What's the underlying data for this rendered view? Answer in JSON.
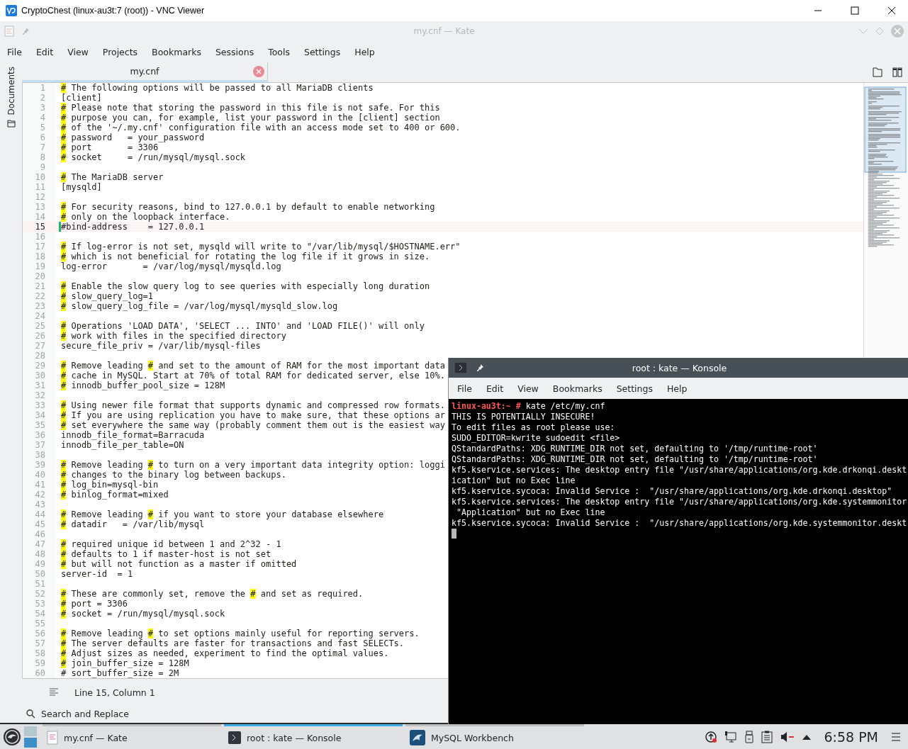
{
  "vnc_window": {
    "title": "CryptoChest (linux-au3t:7 (root)) - VNC Viewer"
  },
  "kate": {
    "title": "my.cnf — Kate",
    "menu": [
      "File",
      "Edit",
      "View",
      "Projects",
      "Bookmarks",
      "Sessions",
      "Tools",
      "Settings",
      "Help"
    ],
    "sidebar_tab": "Documents",
    "tabs": [
      {
        "label": "my.cnf",
        "selected": true
      }
    ],
    "lines": [
      {
        "number": "1",
        "current": false,
        "segments": [
          {
            "text": "#",
            "highlighted": true
          },
          {
            "text": " The following options will be passed to all MariaDB clients",
            "highlighted": false
          }
        ]
      },
      {
        "number": "2",
        "current": false,
        "segments": [
          {
            "text": "[client]",
            "highlighted": false
          }
        ]
      },
      {
        "number": "3",
        "current": false,
        "segments": [
          {
            "text": "#",
            "highlighted": true
          },
          {
            "text": " Please note that storing the password in this file is not safe. For this",
            "highlighted": false
          }
        ]
      },
      {
        "number": "4",
        "current": false,
        "segments": [
          {
            "text": "#",
            "highlighted": true
          },
          {
            "text": " purpose you can, for example, list your password in the [client] section",
            "highlighted": false
          }
        ]
      },
      {
        "number": "5",
        "current": false,
        "segments": [
          {
            "text": "#",
            "highlighted": true
          },
          {
            "text": " of the '~/.my.cnf' configuration file with an access mode set to 400 or 600.",
            "highlighted": false
          }
        ]
      },
      {
        "number": "6",
        "current": false,
        "segments": [
          {
            "text": "#",
            "highlighted": true
          },
          {
            "text": " password   = your_password",
            "highlighted": false
          }
        ]
      },
      {
        "number": "7",
        "current": false,
        "segments": [
          {
            "text": "#",
            "highlighted": true
          },
          {
            "text": " port       = 3306",
            "highlighted": false
          }
        ]
      },
      {
        "number": "8",
        "current": false,
        "segments": [
          {
            "text": "#",
            "highlighted": true
          },
          {
            "text": " socket     = /run/mysql/mysql.sock",
            "highlighted": false
          }
        ]
      },
      {
        "number": "9",
        "current": false
      },
      {
        "number": "10",
        "current": false,
        "segments": [
          {
            "text": "#",
            "highlighted": true
          },
          {
            "text": " The MariaDB server",
            "highlighted": false
          }
        ]
      },
      {
        "number": "11",
        "current": false,
        "segments": [
          {
            "text": "[mysqld]",
            "highlighted": false
          }
        ]
      },
      {
        "number": "12",
        "current": false
      },
      {
        "number": "13",
        "current": false,
        "segments": [
          {
            "text": "#",
            "highlighted": true
          },
          {
            "text": " For security reasons, bind to 127.0.0.1 by default to enable networking",
            "highlighted": false
          }
        ]
      },
      {
        "number": "14",
        "current": false,
        "segments": [
          {
            "text": "#",
            "highlighted": true
          },
          {
            "text": " only on the loopback interface.",
            "highlighted": false
          }
        ]
      },
      {
        "number": "15",
        "current": true,
        "segments": [
          {
            "text": "#bind-address    = 127.0.0.1",
            "highlighted": false
          }
        ]
      },
      {
        "number": "16",
        "current": false
      },
      {
        "number": "17",
        "current": false,
        "segments": [
          {
            "text": "#",
            "highlighted": true
          },
          {
            "text": " If log-error is not set, mysqld will write to \"/var/lib/mysql/$HOSTNAME.err\"",
            "highlighted": false
          }
        ]
      },
      {
        "number": "18",
        "current": false,
        "segments": [
          {
            "text": "#",
            "highlighted": true
          },
          {
            "text": " which is not beneficial for rotating the log file if it grows in size.",
            "highlighted": false
          }
        ]
      },
      {
        "number": "19",
        "current": false,
        "segments": [
          {
            "text": "log-error       = /var/log/mysql/mysqld.log",
            "highlighted": false
          }
        ]
      },
      {
        "number": "20",
        "current": false
      },
      {
        "number": "21",
        "current": false,
        "segments": [
          {
            "text": "#",
            "highlighted": true
          },
          {
            "text": " Enable the slow query log to see queries with especially long duration",
            "highlighted": false
          }
        ]
      },
      {
        "number": "22",
        "current": false,
        "segments": [
          {
            "text": "#",
            "highlighted": true
          },
          {
            "text": " slow_query_log=1",
            "highlighted": false
          }
        ]
      },
      {
        "number": "23",
        "current": false,
        "segments": [
          {
            "text": "#",
            "highlighted": true
          },
          {
            "text": " slow_query_log_file = /var/log/mysql/mysqld_slow.log",
            "highlighted": false
          }
        ]
      },
      {
        "number": "24",
        "current": false
      },
      {
        "number": "25",
        "current": false,
        "segments": [
          {
            "text": "#",
            "highlighted": true
          },
          {
            "text": " Operations 'LOAD DATA', 'SELECT ... INTO' and 'LOAD FILE()' will only",
            "highlighted": false
          }
        ]
      },
      {
        "number": "26",
        "current": false,
        "segments": [
          {
            "text": "#",
            "highlighted": true
          },
          {
            "text": " work with files in the specified directory",
            "highlighted": false
          }
        ]
      },
      {
        "number": "27",
        "current": false,
        "segments": [
          {
            "text": "secure_file_priv = /var/lib/mysql-files",
            "highlighted": false
          }
        ]
      },
      {
        "number": "28",
        "current": false
      },
      {
        "number": "29",
        "current": false,
        "segments": [
          {
            "text": "#",
            "highlighted": true
          },
          {
            "text": " Remove leading ",
            "highlighted": false
          },
          {
            "text": "#",
            "highlighted": true
          },
          {
            "text": " and set to the amount of RAM for the most important data",
            "highlighted": false
          }
        ]
      },
      {
        "number": "30",
        "current": false,
        "segments": [
          {
            "text": "#",
            "highlighted": true
          },
          {
            "text": " cache in MySQL. Start at 70% of total RAM for dedicated server, else 10%.",
            "highlighted": false
          }
        ]
      },
      {
        "number": "31",
        "current": false,
        "segments": [
          {
            "text": "#",
            "highlighted": true
          },
          {
            "text": " innodb_buffer_pool_size = 128M",
            "highlighted": false
          }
        ]
      },
      {
        "number": "32",
        "current": false
      },
      {
        "number": "33",
        "current": false,
        "segments": [
          {
            "text": "#",
            "highlighted": true
          },
          {
            "text": " Using newer file format that supports dynamic and compressed row formats.",
            "highlighted": false
          }
        ]
      },
      {
        "number": "34",
        "current": false,
        "segments": [
          {
            "text": "#",
            "highlighted": true
          },
          {
            "text": " If you are using replication you have to make sure, that these options ar",
            "highlighted": false
          }
        ]
      },
      {
        "number": "35",
        "current": false,
        "segments": [
          {
            "text": "#",
            "highlighted": true
          },
          {
            "text": " set everywhere the same way (probably comment them out is the easiest way",
            "highlighted": false
          }
        ]
      },
      {
        "number": "36",
        "current": false,
        "segments": [
          {
            "text": "innodb_file_format=Barracuda",
            "highlighted": false
          }
        ]
      },
      {
        "number": "37",
        "current": false,
        "segments": [
          {
            "text": "innodb_file_per_table=ON",
            "highlighted": false
          }
        ]
      },
      {
        "number": "38",
        "current": false
      },
      {
        "number": "39",
        "current": false,
        "segments": [
          {
            "text": "#",
            "highlighted": true
          },
          {
            "text": " Remove leading ",
            "highlighted": false
          },
          {
            "text": "#",
            "highlighted": true
          },
          {
            "text": " to turn on a very important data integrity option: loggi",
            "highlighted": false
          }
        ]
      },
      {
        "number": "40",
        "current": false,
        "segments": [
          {
            "text": "#",
            "highlighted": true
          },
          {
            "text": " changes to the binary log between backups.",
            "highlighted": false
          }
        ]
      },
      {
        "number": "41",
        "current": false,
        "segments": [
          {
            "text": "#",
            "highlighted": true
          },
          {
            "text": " log_bin=mysql-bin",
            "highlighted": false
          }
        ]
      },
      {
        "number": "42",
        "current": false,
        "segments": [
          {
            "text": "#",
            "highlighted": true
          },
          {
            "text": " binlog_format=mixed",
            "highlighted": false
          }
        ]
      },
      {
        "number": "43",
        "current": false
      },
      {
        "number": "44",
        "current": false,
        "segments": [
          {
            "text": "#",
            "highlighted": true
          },
          {
            "text": " Remove leading ",
            "highlighted": false
          },
          {
            "text": "#",
            "highlighted": true
          },
          {
            "text": " if you want to store your database elsewhere",
            "highlighted": false
          }
        ]
      },
      {
        "number": "45",
        "current": false,
        "segments": [
          {
            "text": "#",
            "highlighted": true
          },
          {
            "text": " datadir   = /var/lib/mysql",
            "highlighted": false
          }
        ]
      },
      {
        "number": "46",
        "current": false
      },
      {
        "number": "47",
        "current": false,
        "segments": [
          {
            "text": "#",
            "highlighted": true
          },
          {
            "text": " required unique id between 1 and 2^32 - 1",
            "highlighted": false
          }
        ]
      },
      {
        "number": "48",
        "current": false,
        "segments": [
          {
            "text": "#",
            "highlighted": true
          },
          {
            "text": " defaults to 1 if master-host is not set",
            "highlighted": false
          }
        ]
      },
      {
        "number": "49",
        "current": false,
        "segments": [
          {
            "text": "#",
            "highlighted": true
          },
          {
            "text": " but will not function as a master if omitted",
            "highlighted": false
          }
        ]
      },
      {
        "number": "50",
        "current": false,
        "segments": [
          {
            "text": "server-id  = 1",
            "highlighted": false
          }
        ]
      },
      {
        "number": "51",
        "current": false
      },
      {
        "number": "52",
        "current": false,
        "segments": [
          {
            "text": "#",
            "highlighted": true
          },
          {
            "text": " These are commonly set, remove the ",
            "highlighted": false
          },
          {
            "text": "#",
            "highlighted": true
          },
          {
            "text": " and set as required.",
            "highlighted": false
          }
        ]
      },
      {
        "number": "53",
        "current": false,
        "segments": [
          {
            "text": "#",
            "highlighted": true
          },
          {
            "text": " port = 3306",
            "highlighted": false
          }
        ]
      },
      {
        "number": "54",
        "current": false,
        "segments": [
          {
            "text": "#",
            "highlighted": true
          },
          {
            "text": " socket = /run/mysql/mysql.sock",
            "highlighted": false
          }
        ]
      },
      {
        "number": "55",
        "current": false
      },
      {
        "number": "56",
        "current": false,
        "segments": [
          {
            "text": "#",
            "highlighted": true
          },
          {
            "text": " Remove leading ",
            "highlighted": false
          },
          {
            "text": "#",
            "highlighted": true
          },
          {
            "text": " to set options mainly useful for reporting servers.",
            "highlighted": false
          }
        ]
      },
      {
        "number": "57",
        "current": false,
        "segments": [
          {
            "text": "#",
            "highlighted": true
          },
          {
            "text": " The server defaults are faster for transactions and fast SELECTs.",
            "highlighted": false
          }
        ]
      },
      {
        "number": "58",
        "current": false,
        "segments": [
          {
            "text": "#",
            "highlighted": true
          },
          {
            "text": " Adjust sizes as needed, experiment to find the optimal values.",
            "highlighted": false
          }
        ]
      },
      {
        "number": "59",
        "current": false,
        "segments": [
          {
            "text": "#",
            "highlighted": true
          },
          {
            "text": " join_buffer_size = 128M",
            "highlighted": false
          }
        ]
      },
      {
        "number": "60",
        "current": false,
        "segments": [
          {
            "text": "# sort_buffer_size = 2M",
            "highlighted": false
          }
        ]
      }
    ],
    "status": "Line 15, Column 1",
    "bottom_panel": "Search and Replace"
  },
  "konsole": {
    "title": "root : kate — Konsole",
    "menu": [
      "File",
      "Edit",
      "View",
      "Bookmarks",
      "Settings",
      "Help"
    ],
    "output": [
      {
        "kind": "prompt",
        "prompt": "linux-au3t:~ #",
        "text": "kate /etc/my.cnf"
      },
      {
        "kind": "plain",
        "text": "THIS IS POTENTIALLY INSECURE!"
      },
      {
        "kind": "plain",
        "text": "To edit files as root please use:"
      },
      {
        "kind": "plain",
        "text": "SUDO_EDITOR=kwrite sudoedit <file>"
      },
      {
        "kind": "plain",
        "text": "QStandardPaths: XDG_RUNTIME_DIR not set, defaulting to '/tmp/runtime-root'"
      },
      {
        "kind": "plain",
        "text": "QStandardPaths: XDG_RUNTIME_DIR not set, defaulting to '/tmp/runtime-root'"
      },
      {
        "kind": "plain",
        "text": "kf5.kservice.services: The desktop entry file \"/usr/share/applications/org.kde.drkonqi.deskt"
      },
      {
        "kind": "plain",
        "text": "ication\" but no Exec line"
      },
      {
        "kind": "plain",
        "text": "kf5.kservice.sycoca: Invalid Service :  \"/usr/share/applications/org.kde.drkonqi.desktop\""
      },
      {
        "kind": "plain",
        "text": "kf5.kservice.services: The desktop entry file \"/usr/share/applications/org.kde.systemmonitor"
      },
      {
        "kind": "plain",
        "text": " \"Application\" but no Exec line"
      },
      {
        "kind": "plain",
        "text": "kf5.kservice.sycoca: Invalid Service :  \"/usr/share/applications/org.kde.systemmonitor.deskt"
      },
      {
        "kind": "cursor"
      }
    ]
  },
  "taskbar": {
    "tasks": [
      {
        "kind": "kate",
        "label": "my.cnf  — Kate",
        "selected": false
      },
      {
        "kind": "konsole",
        "label": "root : kate — Konsole",
        "selected": true
      },
      {
        "kind": "workbench",
        "label": "MySQL Workbench",
        "selected": false
      }
    ],
    "clock": "6:58 PM"
  }
}
